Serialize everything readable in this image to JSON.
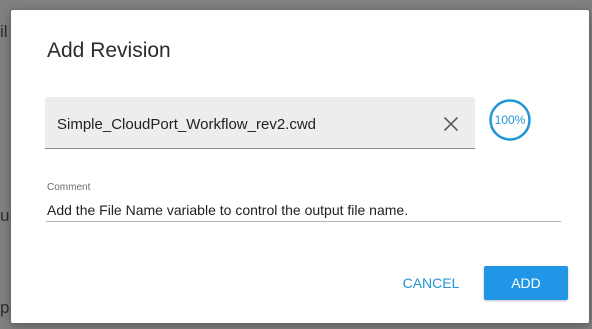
{
  "dialog": {
    "title": "Add Revision",
    "file_name": "Simple_CloudPort_Workflow_rev2.cwd",
    "progress_label": "100%",
    "progress_value": 1.0,
    "comment_label": "Comment",
    "comment_value": "Add the File Name variable to control the output file name.",
    "cancel_label": "CANCEL",
    "add_label": "ADD",
    "icons": {
      "clear": "close-icon"
    }
  },
  "colors": {
    "accent": "#2196E6",
    "text_button": "#2196D6",
    "backdrop": "#808080",
    "field_background": "#EDEDED"
  }
}
